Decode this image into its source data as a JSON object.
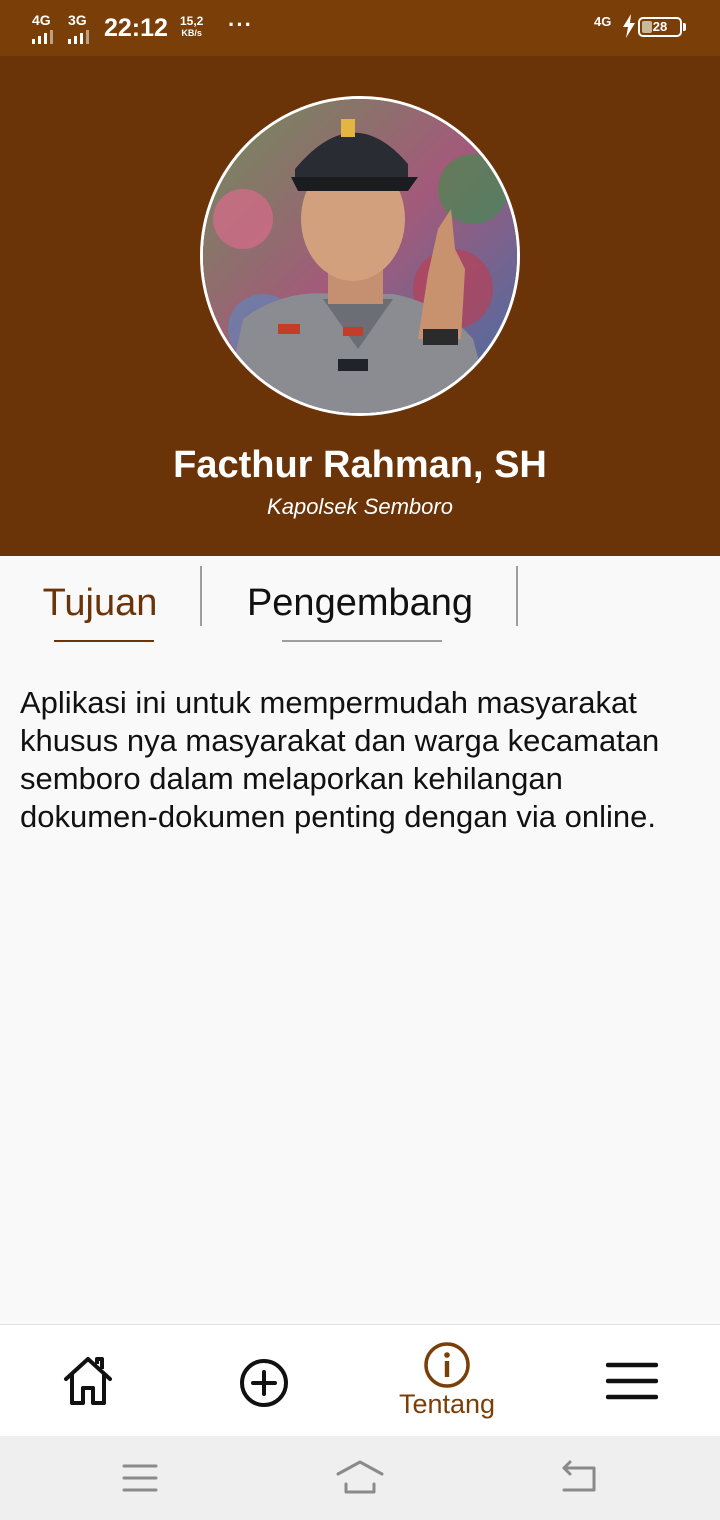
{
  "status_bar": {
    "network_1": "4G",
    "network_2": "3G",
    "time": "22:12",
    "speed_value": "15,2",
    "speed_unit": "KB/s",
    "more": "···",
    "network_right": "4G",
    "battery_level": "28",
    "battery_fraction": 0.28
  },
  "profile": {
    "name": "Facthur Rahman, SH",
    "role": "Kapolsek Semboro"
  },
  "tabs": [
    {
      "label": "Tujuan",
      "active": true
    },
    {
      "label": "Pengembang",
      "active": false
    }
  ],
  "about": {
    "text": "Aplikasi ini untuk mempermudah masyarakat khusus nya masyarakat dan warga kecamatan semboro dalam melaporkan kehilangan dokumen-dokumen penting dengan via online."
  },
  "bottom_nav": {
    "items": [
      {
        "icon": "home-icon",
        "label": ""
      },
      {
        "icon": "add-circle-icon",
        "label": ""
      },
      {
        "icon": "info-icon",
        "label": "Tentang",
        "active": true
      },
      {
        "icon": "menu-icon",
        "label": ""
      }
    ]
  },
  "system_nav": {
    "icons": [
      "recent-apps-icon",
      "home-button-icon",
      "back-icon"
    ]
  },
  "colors": {
    "status_bar": "#7a3f08",
    "header": "#6a3408",
    "accent": "#7a3f08",
    "text": "#111111"
  }
}
